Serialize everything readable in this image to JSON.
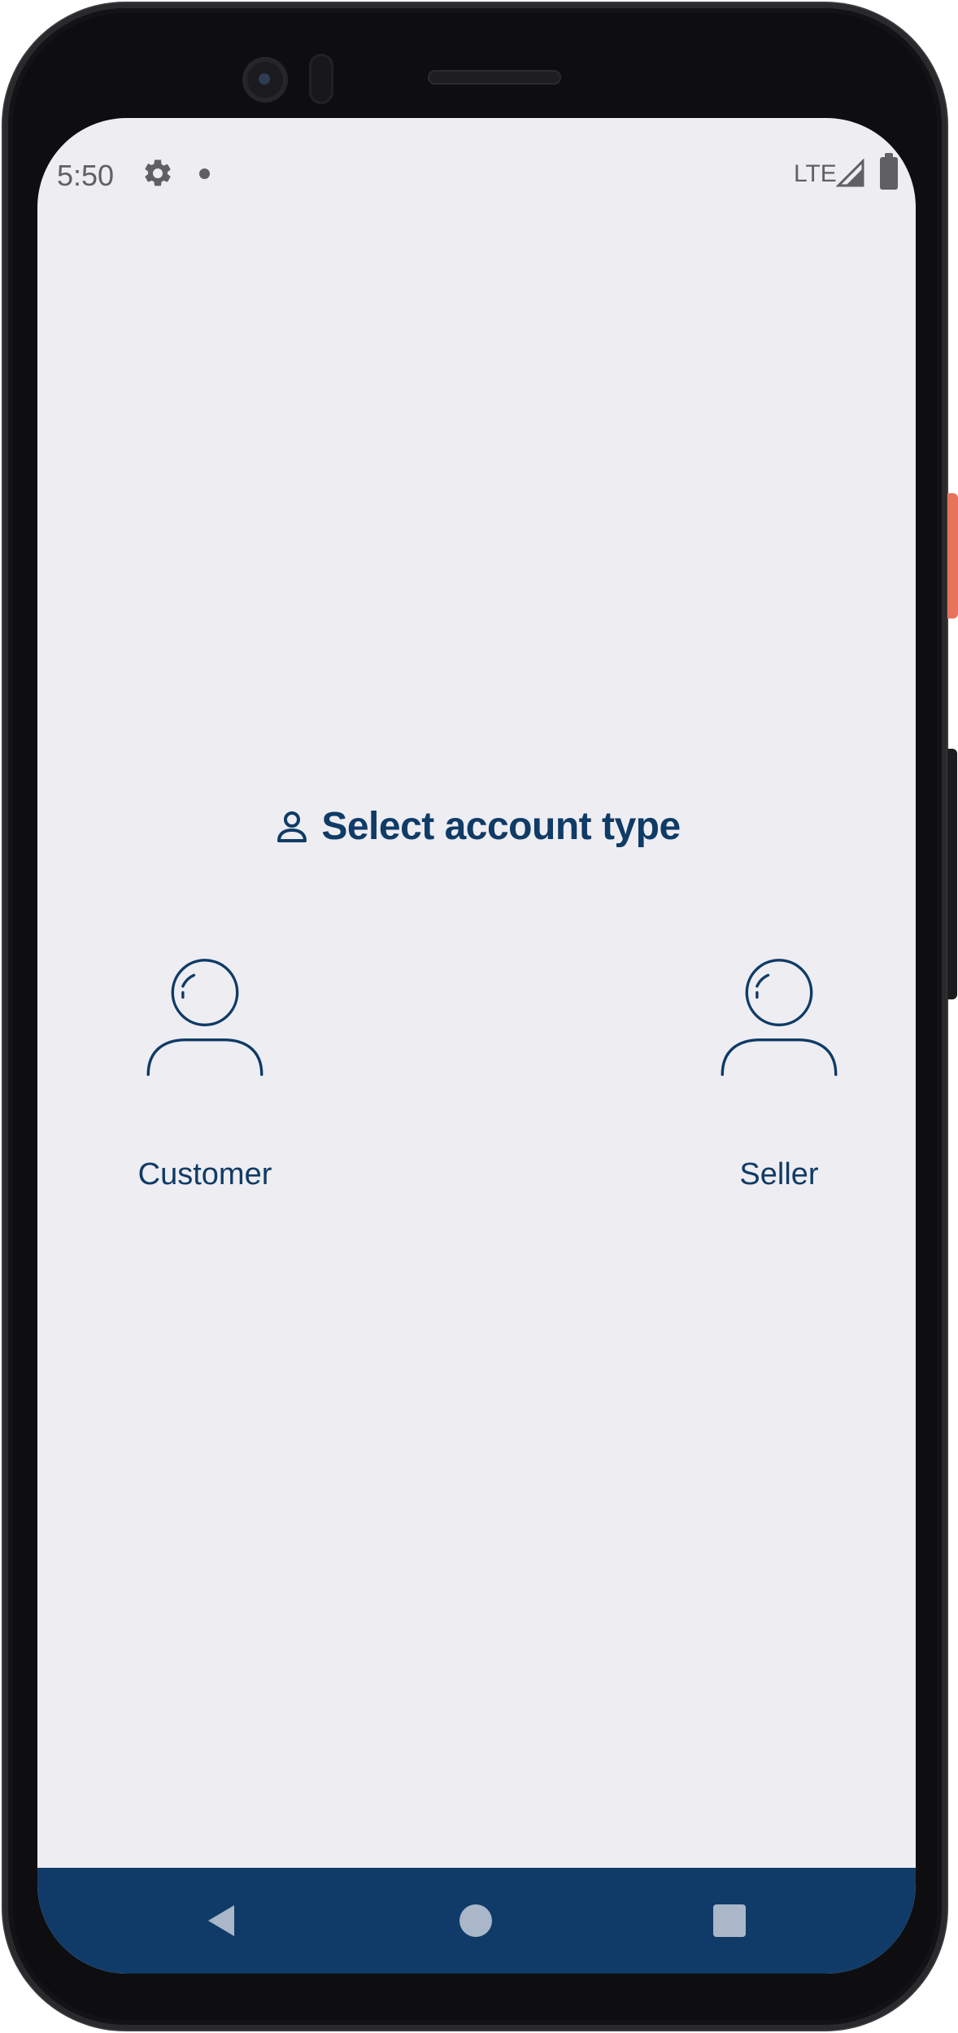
{
  "status_bar": {
    "time": "5:50",
    "network": "LTE",
    "icons": [
      "gear-icon",
      "notification-dot-icon",
      "signal-icon",
      "battery-icon"
    ]
  },
  "main": {
    "title": "Select account type",
    "title_icon": "person-icon",
    "options": [
      {
        "label": "Customer",
        "icon": "user-avatar-icon"
      },
      {
        "label": "Seller",
        "icon": "user-avatar-icon"
      }
    ]
  },
  "nav_bar": {
    "buttons": [
      "back-icon",
      "home-icon",
      "recents-icon"
    ]
  },
  "colors": {
    "accent": "#0f3b66",
    "background": "#eeedf2",
    "nav_bar": "#103b69",
    "status_text": "#5f5f64"
  }
}
